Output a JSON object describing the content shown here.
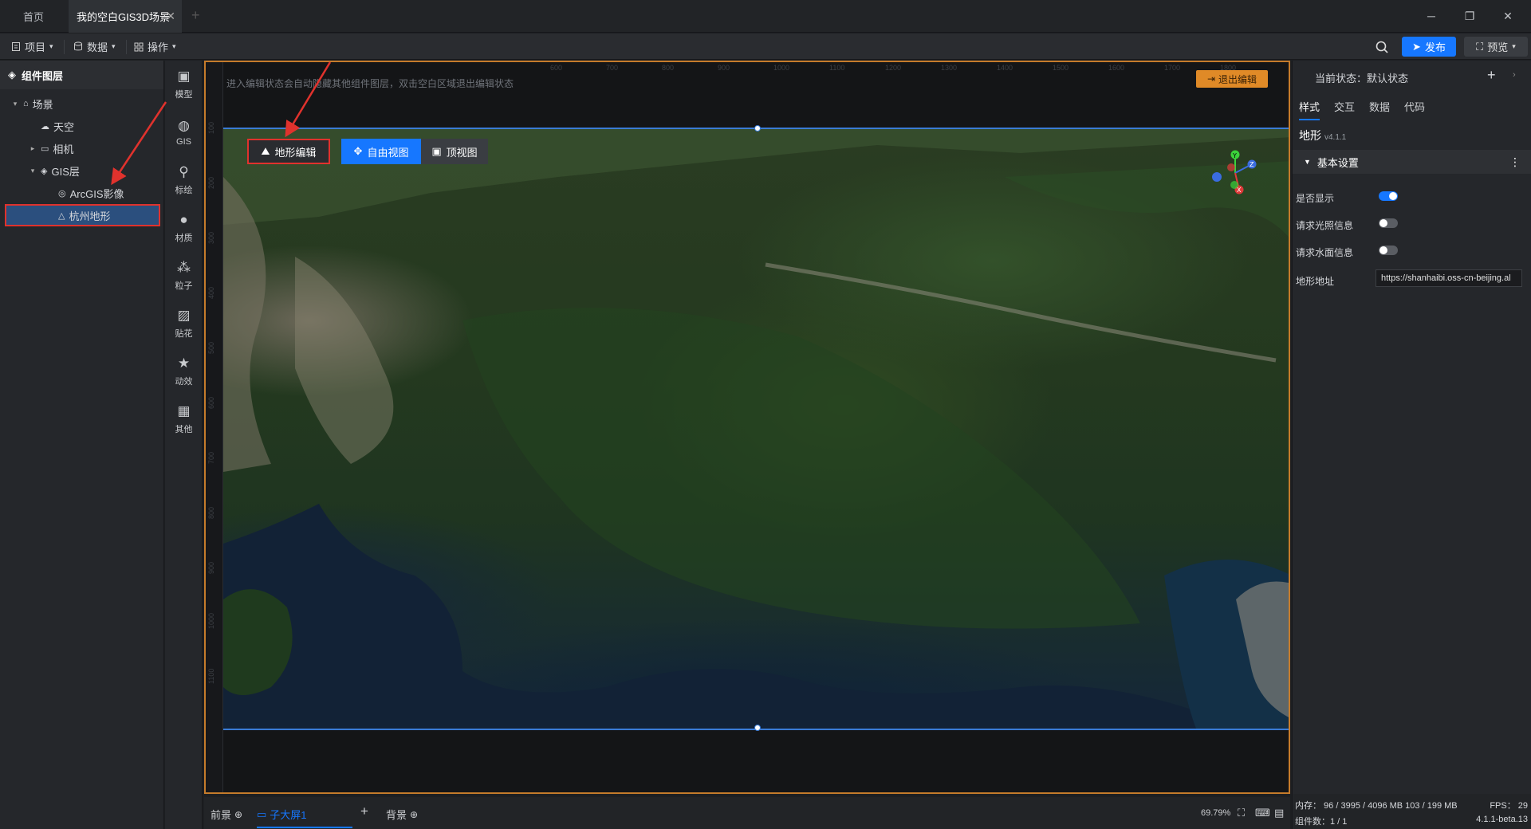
{
  "tabs": {
    "home": "首页",
    "active": "我的空白GIS3D场景",
    "add": "+"
  },
  "window": {
    "minimize": "─",
    "restore": "❐",
    "close": "✕"
  },
  "toolbar": {
    "project": "项目",
    "data": "数据",
    "operate": "操作",
    "publish": "发布",
    "preview": "预览"
  },
  "layers": {
    "title": "组件图层",
    "items": [
      {
        "label": "场景",
        "level": 0,
        "caret": "▾"
      },
      {
        "label": "天空",
        "level": 1,
        "caret": ""
      },
      {
        "label": "相机",
        "level": 1,
        "caret": "▸"
      },
      {
        "label": "GIS层",
        "level": 1,
        "caret": "▾"
      },
      {
        "label": "ArcGIS影像",
        "level": 2,
        "caret": ""
      },
      {
        "label": "杭州地形",
        "level": 2,
        "caret": "",
        "selected": true
      }
    ]
  },
  "iconbar": [
    {
      "label": "模型",
      "icon": "cube-icon"
    },
    {
      "label": "GIS",
      "icon": "globe-icon"
    },
    {
      "label": "标绘",
      "icon": "pin-icon"
    },
    {
      "label": "材质",
      "icon": "sphere-icon"
    },
    {
      "label": "粒子",
      "icon": "particle-icon"
    },
    {
      "label": "贴花",
      "icon": "image-icon"
    },
    {
      "label": "动效",
      "icon": "star-icon"
    },
    {
      "label": "其他",
      "icon": "grid-icon"
    }
  ],
  "canvas": {
    "hint": "进入编辑状态会自动隐藏其他组件图层，双击空白区域退出编辑状态",
    "exit_button": "退出编辑",
    "terrain_edit": "地形编辑",
    "free_view": "自由视图",
    "top_view": "顶视图",
    "ruler_top": [
      "600",
      "700",
      "800",
      "900",
      "1000",
      "1100",
      "1200",
      "1300",
      "1400",
      "1500",
      "1600",
      "1700",
      "1800"
    ],
    "ruler_left": [
      "100",
      "200",
      "300",
      "400",
      "500",
      "600",
      "700",
      "800",
      "900",
      "1000",
      "1100"
    ],
    "axis": {
      "x": "X",
      "y": "Y",
      "z": "Z"
    }
  },
  "bottom": {
    "foreground": "前景",
    "sub_screen": "子大屏1",
    "add": "+",
    "background": "背景",
    "zoom": "69.79%"
  },
  "right": {
    "state_label": "当前状态：",
    "state_value": "默认状态",
    "tabs": [
      "样式",
      "交互",
      "数据",
      "代码"
    ],
    "component": "地形",
    "version": "v4.1.1",
    "section": "基本设置",
    "props": [
      {
        "label": "是否显示",
        "on": true
      },
      {
        "label": "请求光照信息",
        "on": false
      },
      {
        "label": "请求水面信息",
        "on": false
      }
    ],
    "url_label": "地形地址",
    "url_value": "https://shanhaibi.oss-cn-beijing.al"
  },
  "status": {
    "memory": "内存：  96 / 3995 / 4096 MB  103 / 199 MB",
    "fps": "FPS：  29",
    "components": "组件数：1 / 1",
    "version": "4.1.1-beta.13"
  },
  "colors": {
    "accent": "#1677ff",
    "highlight": "#e0322d",
    "edit_border": "#c57b2b",
    "exit_btn": "#e08a27"
  }
}
